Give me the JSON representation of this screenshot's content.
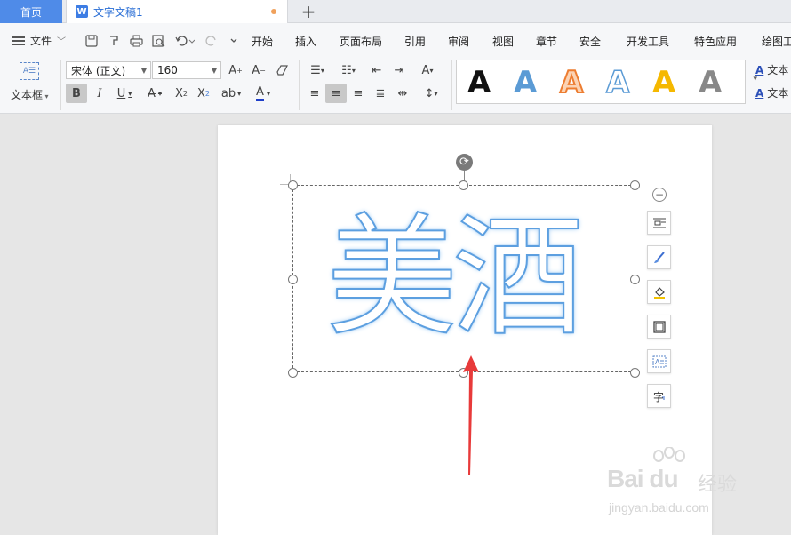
{
  "tabs": {
    "home": "首页",
    "doc_title": "文字文稿1",
    "doc_icon": "W",
    "add": "+"
  },
  "menu": {
    "file": "文件",
    "items": [
      "开始",
      "插入",
      "页面布局",
      "引用",
      "审阅",
      "视图",
      "章节",
      "安全",
      "开发工具",
      "特色应用",
      "绘图工"
    ]
  },
  "ribbon": {
    "textbox_label": "文本框",
    "font_name": "宋体 (正文)",
    "font_size": "160",
    "style_gallery": [
      "A",
      "A",
      "A",
      "A",
      "A",
      "A"
    ],
    "right_items": [
      "文本",
      "文本"
    ]
  },
  "document": {
    "art_text": "美酒"
  },
  "watermark": {
    "logo": "Bai du",
    "brand": "经验",
    "url": "jingyan.baidu.com"
  },
  "colors": {
    "home_tab": "#4f8be8",
    "art_stroke": "#5c9fe0",
    "arrow": "#e83a3a",
    "style_colors": [
      "#000000",
      "#5b9bd5",
      "#ed7d31",
      "#5b9bd5",
      "#f5b800",
      "#777777"
    ]
  }
}
